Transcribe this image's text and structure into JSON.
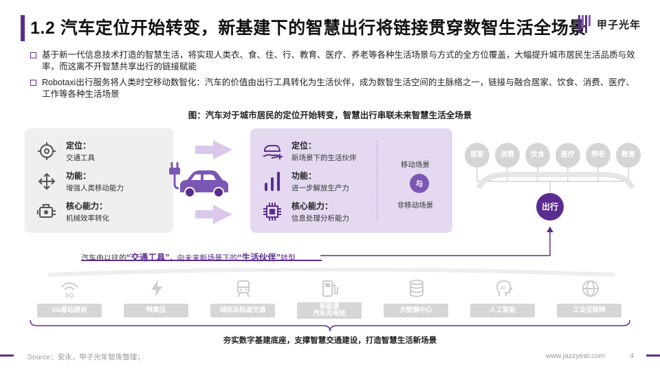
{
  "header": {
    "title": "1.2 汽车定位开始转变，新基建下的智慧出行将链接贯穿数智生活全场景",
    "logo_text": "甲子光年"
  },
  "bullets": [
    "基于新一代信息技术打造的智慧生活，将实现人类衣、食、住、行、教育、医疗、养老等各种生活场景与方式的全方位覆盖，大幅提升城市居民生活品质与效率，而这离不开智慧共享出行的链接赋能",
    "Robotaxi出行服务将人类时空移动数智化：汽车的价值由出行工具转化为生活伙伴，成为数智生活空间的主脉络之一，链接与融合居家、饮食、消费、医疗、工作等各种生活场景"
  ],
  "figure": {
    "caption": "图：汽车对于城市居民的定位开始转变，智慧出行串联未来智慧生活全场景",
    "left_panel": [
      {
        "heading": "定位：",
        "sub": "交通工具",
        "icon": "target-icon"
      },
      {
        "heading": "功能：",
        "sub": "增强人类移动能力",
        "icon": "move-arrows-icon"
      },
      {
        "heading": "核心能力：",
        "sub": "机械效率转化",
        "icon": "engine-icon"
      }
    ],
    "mid_panel": [
      {
        "heading": "定位：",
        "sub": "新场景下的生活伙伴",
        "icon": "car-hand-icon"
      },
      {
        "heading": "功能：",
        "sub": "进一步解放生产力",
        "icon": "bars-icon"
      },
      {
        "heading": "核心能力：",
        "sub": "信息处理分析能力",
        "icon": "chip-icon"
      }
    ],
    "scene_mobile": "移动场景",
    "scene_and": "与",
    "scene_static": "非移动场景",
    "life_scenes": [
      "居家",
      "消费",
      "饮食",
      "医疗",
      "养老",
      "教育"
    ],
    "out_label": "出行",
    "transform": {
      "prefix": "汽车由以往的",
      "q_open": "“",
      "term1": "交通工具",
      "q_close": "”",
      "middle": "，向未来新场景下的",
      "q2_open": "“",
      "term2": "生活伙伴",
      "q2_close": "”",
      "suffix": "转型"
    },
    "infra": [
      {
        "label": "5G基站建设",
        "icon": "5g-signal-icon"
      },
      {
        "label": "特高压",
        "icon": "lightning-icon"
      },
      {
        "label": "城际及轨道交通",
        "icon": "train-icon"
      },
      {
        "label": "新能源\n汽车充电桩",
        "icon": "charging-pile-icon"
      },
      {
        "label": "大数据中心",
        "icon": "database-icon"
      },
      {
        "label": "人工智能",
        "icon": "ai-head-icon"
      },
      {
        "label": "工业互联网",
        "icon": "industrial-network-icon"
      }
    ],
    "infra_caption": "夯实数字基建底座，支撑智慧交通建设，打造智慧生活新场景"
  },
  "footer": {
    "source": "Source：安永，甲子光年智库整理；",
    "site": "www.jazzyear.com",
    "page": "4"
  },
  "colors": {
    "accent": "#5b2c8f",
    "panel_left": "#efefef",
    "panel_mid": "#e4d9f1",
    "arrow": "#d9c8ec",
    "scene_gray": "#d5d5d5"
  }
}
